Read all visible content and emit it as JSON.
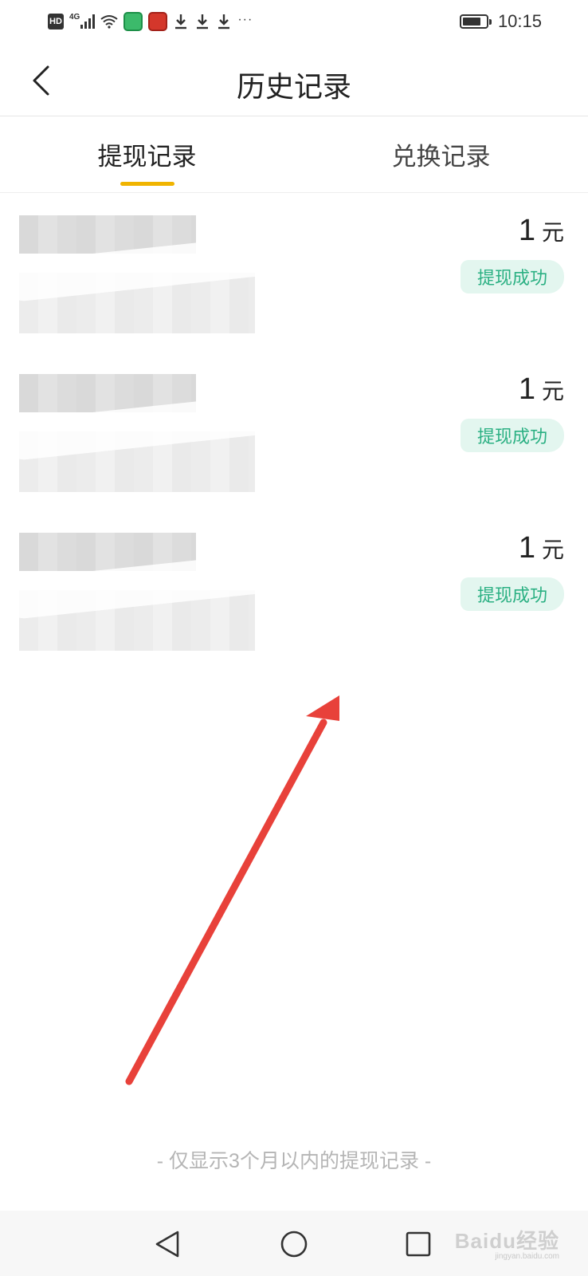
{
  "status_bar": {
    "hd": "HD",
    "network": "4G",
    "time": "10:15",
    "more": "···"
  },
  "header": {
    "title": "历史记录"
  },
  "tabs": [
    {
      "label": "提现记录",
      "active": true
    },
    {
      "label": "兑换记录",
      "active": false
    }
  ],
  "records": [
    {
      "amount": "1",
      "unit": "元",
      "status": "提现成功"
    },
    {
      "amount": "1",
      "unit": "元",
      "status": "提现成功"
    },
    {
      "amount": "1",
      "unit": "元",
      "status": "提现成功"
    }
  ],
  "footer_note": "- 仅显示3个月以内的提现记录 -",
  "watermark": {
    "text": "Baidu经验",
    "sub": "jingyan.baidu.com"
  },
  "colors": {
    "accent": "#f0b400",
    "success_text": "#2bb083",
    "success_bg": "#e3f6ef",
    "annotation_arrow": "#e8413a"
  }
}
